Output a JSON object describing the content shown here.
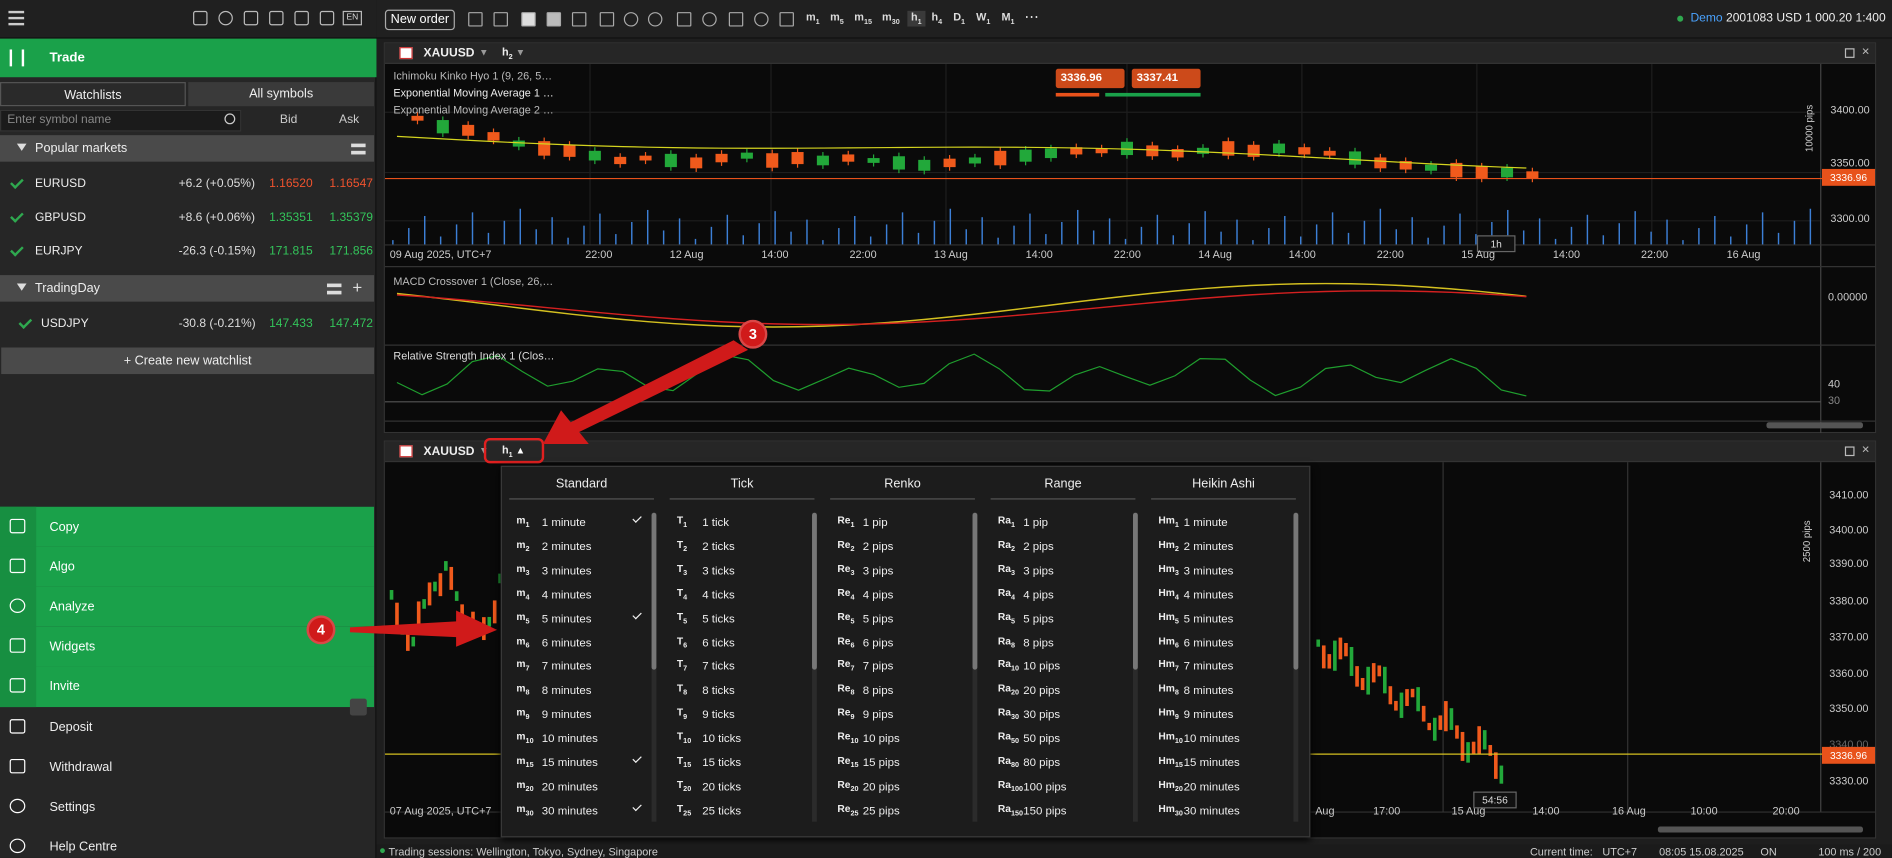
{
  "sidebar": {
    "trade_label": "Trade",
    "tabs": [
      {
        "label": "Watchlists"
      },
      {
        "label": "All symbols"
      }
    ],
    "search_placeholder": "Enter symbol name",
    "col_bid": "Bid",
    "col_ask": "Ask",
    "popular": {
      "title": "Popular markets",
      "rows": [
        {
          "symbol": "EURUSD",
          "change": "+6.2 (+0.05%)",
          "bid": "1.16520",
          "ask": "1.16547"
        },
        {
          "symbol": "GBPUSD",
          "change": "+8.6 (+0.06%)",
          "bid": "1.35351",
          "ask": "1.35379"
        },
        {
          "symbol": "EURJPY",
          "change": "-26.3 (-0.15%)",
          "bid": "171.815",
          "ask": "171.856"
        }
      ]
    },
    "tradingday": {
      "title": "TradingDay",
      "rows": [
        {
          "symbol": "USDJPY",
          "change": "-30.8 (-0.21%)",
          "bid": "147.433",
          "ask": "147.472"
        }
      ]
    },
    "create_watchlist": "+ Create new watchlist",
    "menu": [
      {
        "label": "Copy"
      },
      {
        "label": "Algo"
      },
      {
        "label": "Analyze"
      },
      {
        "label": "Widgets"
      },
      {
        "label": "Invite"
      },
      {
        "label": "Deposit"
      },
      {
        "label": "Withdrawal"
      },
      {
        "label": "Settings"
      },
      {
        "label": "Help Centre"
      }
    ]
  },
  "toolbar": {
    "new_order": "New order",
    "timeframes": [
      {
        "l": "m",
        "n": "1"
      },
      {
        "l": "m",
        "n": "5"
      },
      {
        "l": "m",
        "n": "15"
      },
      {
        "l": "m",
        "n": "30"
      },
      {
        "l": "h",
        "n": "1"
      },
      {
        "l": "h",
        "n": "4"
      },
      {
        "l": "D",
        "n": "1"
      },
      {
        "l": "W",
        "n": "1"
      },
      {
        "l": "M",
        "n": "1"
      }
    ],
    "account": {
      "mode": "Demo",
      "id": "2001083",
      "balance": "USD 1 000.20",
      "leverage": "1:400"
    }
  },
  "chart1": {
    "symbol": "XAUUSD",
    "timeframe": "h",
    "timeframe_n": "2",
    "indicators": [
      "Ichimoku Kinko Hyo 1 (9, 26, 5…",
      "Exponential Moving Average 1 …",
      "Exponential Moving Average 2 …"
    ],
    "sell_price": "3336.96",
    "buy_price": "3337.41",
    "current_price": "3336.96",
    "scale_label": "10000 pips",
    "y_ticks": [
      "3400.00",
      "3350.00",
      "3300.00"
    ],
    "x_labels": [
      "09 Aug 2025, UTC+7",
      "22:00",
      "12 Aug",
      "14:00",
      "22:00",
      "13 Aug",
      "14:00",
      "22:00",
      "14 Aug",
      "14:00",
      "22:00",
      "15 Aug",
      "14:00",
      "22:00",
      "16 Aug"
    ],
    "countdown": "1h",
    "macd_label": "MACD Crossover 1 (Close, 26,…",
    "macd_tick": "0.00000",
    "rsi_label": "Relative Strength Index 1 (Clos…",
    "rsi_ticks": [
      "40",
      "30"
    ]
  },
  "chart2": {
    "symbol": "XAUUSD",
    "timeframe": "h",
    "timeframe_n": "1",
    "current_price": "3336.96",
    "scale_label": "2500 pips",
    "y_ticks": [
      "3410.00",
      "3400.00",
      "3390.00",
      "3380.00",
      "3370.00",
      "3360.00",
      "3350.00",
      "3340.00",
      "3330.00"
    ],
    "x_labels": [
      "07 Aug 2025, UTC+7",
      "Aug",
      "17:00",
      "15 Aug",
      "14:00",
      "16 Aug",
      "10:00",
      "20:00"
    ],
    "countdown": "54:56"
  },
  "dropdown": {
    "columns": [
      {
        "title": "Standard",
        "items": [
          {
            "l": "m",
            "n": "1",
            "label": "1 minute",
            "checked": true
          },
          {
            "l": "m",
            "n": "2",
            "label": "2 minutes"
          },
          {
            "l": "m",
            "n": "3",
            "label": "3 minutes"
          },
          {
            "l": "m",
            "n": "4",
            "label": "4 minutes"
          },
          {
            "l": "m",
            "n": "5",
            "label": "5 minutes",
            "checked": true
          },
          {
            "l": "m",
            "n": "6",
            "label": "6 minutes"
          },
          {
            "l": "m",
            "n": "7",
            "label": "7 minutes"
          },
          {
            "l": "m",
            "n": "8",
            "label": "8 minutes"
          },
          {
            "l": "m",
            "n": "9",
            "label": "9 minutes"
          },
          {
            "l": "m",
            "n": "10",
            "label": "10 minutes"
          },
          {
            "l": "m",
            "n": "15",
            "label": "15 minutes",
            "checked": true
          },
          {
            "l": "m",
            "n": "20",
            "label": "20 minutes"
          },
          {
            "l": "m",
            "n": "30",
            "label": "30 minutes",
            "checked": true
          }
        ]
      },
      {
        "title": "Tick",
        "items": [
          {
            "l": "T",
            "n": "1",
            "label": "1 tick"
          },
          {
            "l": "T",
            "n": "2",
            "label": "2 ticks"
          },
          {
            "l": "T",
            "n": "3",
            "label": "3 ticks"
          },
          {
            "l": "T",
            "n": "4",
            "label": "4 ticks"
          },
          {
            "l": "T",
            "n": "5",
            "label": "5 ticks"
          },
          {
            "l": "T",
            "n": "6",
            "label": "6 ticks"
          },
          {
            "l": "T",
            "n": "7",
            "label": "7 ticks"
          },
          {
            "l": "T",
            "n": "8",
            "label": "8 ticks"
          },
          {
            "l": "T",
            "n": "9",
            "label": "9 ticks"
          },
          {
            "l": "T",
            "n": "10",
            "label": "10 ticks"
          },
          {
            "l": "T",
            "n": "15",
            "label": "15 ticks"
          },
          {
            "l": "T",
            "n": "20",
            "label": "20 ticks"
          },
          {
            "l": "T",
            "n": "25",
            "label": "25 ticks"
          }
        ]
      },
      {
        "title": "Renko",
        "items": [
          {
            "l": "Re",
            "n": "1",
            "label": "1 pip"
          },
          {
            "l": "Re",
            "n": "2",
            "label": "2 pips"
          },
          {
            "l": "Re",
            "n": "3",
            "label": "3 pips"
          },
          {
            "l": "Re",
            "n": "4",
            "label": "4 pips"
          },
          {
            "l": "Re",
            "n": "5",
            "label": "5 pips"
          },
          {
            "l": "Re",
            "n": "6",
            "label": "6 pips"
          },
          {
            "l": "Re",
            "n": "7",
            "label": "7 pips"
          },
          {
            "l": "Re",
            "n": "8",
            "label": "8 pips"
          },
          {
            "l": "Re",
            "n": "9",
            "label": "9 pips"
          },
          {
            "l": "Re",
            "n": "10",
            "label": "10 pips"
          },
          {
            "l": "Re",
            "n": "15",
            "label": "15 pips"
          },
          {
            "l": "Re",
            "n": "20",
            "label": "20 pips"
          },
          {
            "l": "Re",
            "n": "25",
            "label": "25 pips"
          }
        ]
      },
      {
        "title": "Range",
        "items": [
          {
            "l": "Ra",
            "n": "1",
            "label": "1 pip"
          },
          {
            "l": "Ra",
            "n": "2",
            "label": "2 pips"
          },
          {
            "l": "Ra",
            "n": "3",
            "label": "3 pips"
          },
          {
            "l": "Ra",
            "n": "4",
            "label": "4 pips"
          },
          {
            "l": "Ra",
            "n": "5",
            "label": "5 pips"
          },
          {
            "l": "Ra",
            "n": "8",
            "label": "8 pips"
          },
          {
            "l": "Ra",
            "n": "10",
            "label": "10 pips"
          },
          {
            "l": "Ra",
            "n": "20",
            "label": "20 pips"
          },
          {
            "l": "Ra",
            "n": "30",
            "label": "30 pips"
          },
          {
            "l": "Ra",
            "n": "50",
            "label": "50 pips"
          },
          {
            "l": "Ra",
            "n": "80",
            "label": "80 pips"
          },
          {
            "l": "Ra",
            "n": "100",
            "label": "100 pips"
          },
          {
            "l": "Ra",
            "n": "150",
            "label": "150 pips"
          }
        ]
      },
      {
        "title": "Heikin Ashi",
        "items": [
          {
            "l": "Hm",
            "n": "1",
            "label": "1 minute"
          },
          {
            "l": "Hm",
            "n": "2",
            "label": "2 minutes"
          },
          {
            "l": "Hm",
            "n": "3",
            "label": "3 minutes"
          },
          {
            "l": "Hm",
            "n": "4",
            "label": "4 minutes"
          },
          {
            "l": "Hm",
            "n": "5",
            "label": "5 minutes"
          },
          {
            "l": "Hm",
            "n": "6",
            "label": "6 minutes"
          },
          {
            "l": "Hm",
            "n": "7",
            "label": "7 minutes"
          },
          {
            "l": "Hm",
            "n": "8",
            "label": "8 minutes"
          },
          {
            "l": "Hm",
            "n": "9",
            "label": "9 minutes"
          },
          {
            "l": "Hm",
            "n": "10",
            "label": "10 minutes"
          },
          {
            "l": "Hm",
            "n": "15",
            "label": "15 minutes"
          },
          {
            "l": "Hm",
            "n": "20",
            "label": "20 minutes"
          },
          {
            "l": "Hm",
            "n": "30",
            "label": "30 minutes"
          }
        ]
      }
    ]
  },
  "annotations": {
    "step3": "3",
    "step4": "4"
  },
  "status": {
    "sessions": "Trading sessions: Wellington, Tokyo, Sydney, Singapore",
    "current_time_label": "Current time:",
    "timezone": "UTC+7",
    "time": "08:05 15.08.2025",
    "on": "ON",
    "latency": "100 ms / 200 ms"
  },
  "colors": {
    "accent": "#1aa14a",
    "bear": "#f0532e",
    "bull": "#33c45a",
    "badge": "#d01a1a"
  }
}
